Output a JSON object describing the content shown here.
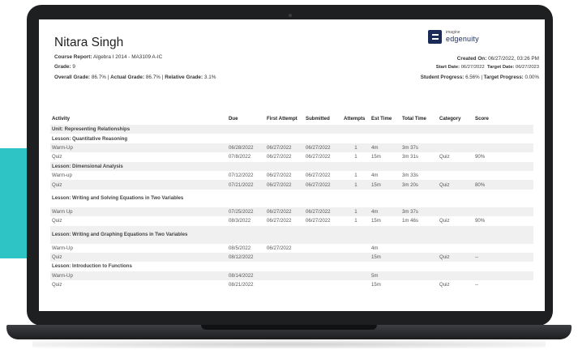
{
  "header": {
    "student_name": "Nitara Singh",
    "course_report_label": "Course Report:",
    "course_report_value": "Algebra I 2014 - MA3109 A-IC",
    "grade_label": "Grade:",
    "grade_value": "9",
    "overall_grade_label": "Overall Grade:",
    "overall_grade_value": "86.7%",
    "actual_grade_label": "Actual Grade:",
    "actual_grade_value": "86.7%",
    "relative_grade_label": "Relative Grade:",
    "relative_grade_value": "3.1%",
    "created_label": "Created On:",
    "created_value": "06/27/2022, 03:26 PM",
    "start_date_label": "Start Date:",
    "start_date_value": "06/27/2022",
    "target_date_label": "Target Date:",
    "target_date_value": "06/27/2023",
    "student_progress_label": "Student Progress:",
    "student_progress_value": "6.56%",
    "target_progress_label": "Target Progress:",
    "target_progress_value": "0.00%"
  },
  "logo": {
    "small": "imagine",
    "big": "edgenuity",
    "mark_icon": "edgenuity-logo-icon"
  },
  "columns": [
    "Activity",
    "Due",
    "First Attempt",
    "Submitted",
    "Attempts",
    "Est Time",
    "Total Time",
    "Category",
    "Score"
  ],
  "rows": [
    {
      "type": "unit",
      "activity": "Unit: Representing Relationships"
    },
    {
      "type": "lesson",
      "activity": "Lesson: Quantitative Reasoning"
    },
    {
      "type": "item",
      "activity": "Warm-Up",
      "due": "06/28/2022",
      "first": "06/27/2022",
      "submitted": "06/27/2022",
      "attempts": "1",
      "est": "4m",
      "total": "3m 37s",
      "category": "",
      "score": ""
    },
    {
      "type": "item",
      "activity": "Quiz",
      "due": "07/8/2022",
      "first": "06/27/2022",
      "submitted": "06/27/2022",
      "attempts": "1",
      "est": "15m",
      "total": "3m 31s",
      "category": "Quiz",
      "score": "90%"
    },
    {
      "type": "lesson",
      "activity": "Lesson: Dimensional Analysis"
    },
    {
      "type": "item",
      "activity": "Warm-up",
      "due": "07/12/2022",
      "first": "06/27/2022",
      "submitted": "06/27/2022",
      "attempts": "1",
      "est": "4m",
      "total": "3m 33s",
      "category": "",
      "score": ""
    },
    {
      "type": "item",
      "activity": "Quiz",
      "due": "07/21/2022",
      "first": "06/27/2022",
      "submitted": "06/27/2022",
      "attempts": "1",
      "est": "15m",
      "total": "3m 20s",
      "category": "Quiz",
      "score": "80%"
    },
    {
      "type": "lesson",
      "activity": "Lesson: Writing and Solving Equations in Two Variables",
      "tall": true
    },
    {
      "type": "item",
      "activity": "Warm Up",
      "due": "07/25/2022",
      "first": "06/27/2022",
      "submitted": "06/27/2022",
      "attempts": "1",
      "est": "4m",
      "total": "3m 37s",
      "category": "",
      "score": ""
    },
    {
      "type": "item",
      "activity": "Quiz",
      "due": "08/3/2022",
      "first": "06/27/2022",
      "submitted": "06/27/2022",
      "attempts": "1",
      "est": "15m",
      "total": "1m 46s",
      "category": "Quiz",
      "score": "90%"
    },
    {
      "type": "lesson",
      "activity": "Lesson: Writing and Graphing Equations in Two Variables",
      "tall": true
    },
    {
      "type": "item",
      "activity": "Warm-Up",
      "due": "08/5/2022",
      "first": "06/27/2022",
      "submitted": "",
      "attempts": "",
      "est": "4m",
      "total": "",
      "category": "",
      "score": ""
    },
    {
      "type": "item",
      "activity": "Quiz",
      "due": "08/12/2022",
      "first": "",
      "submitted": "",
      "attempts": "",
      "est": "15m",
      "total": "",
      "category": "Quiz",
      "score": "--"
    },
    {
      "type": "lesson",
      "activity": "Lesson: Introduction to Functions"
    },
    {
      "type": "item",
      "activity": "Warm-Up",
      "due": "08/14/2022",
      "first": "",
      "submitted": "",
      "attempts": "",
      "est": "5m",
      "total": "",
      "category": "",
      "score": ""
    },
    {
      "type": "item",
      "activity": "Quiz",
      "due": "08/21/2022",
      "first": "",
      "submitted": "",
      "attempts": "",
      "est": "15m",
      "total": "",
      "category": "Quiz",
      "score": "--"
    }
  ]
}
